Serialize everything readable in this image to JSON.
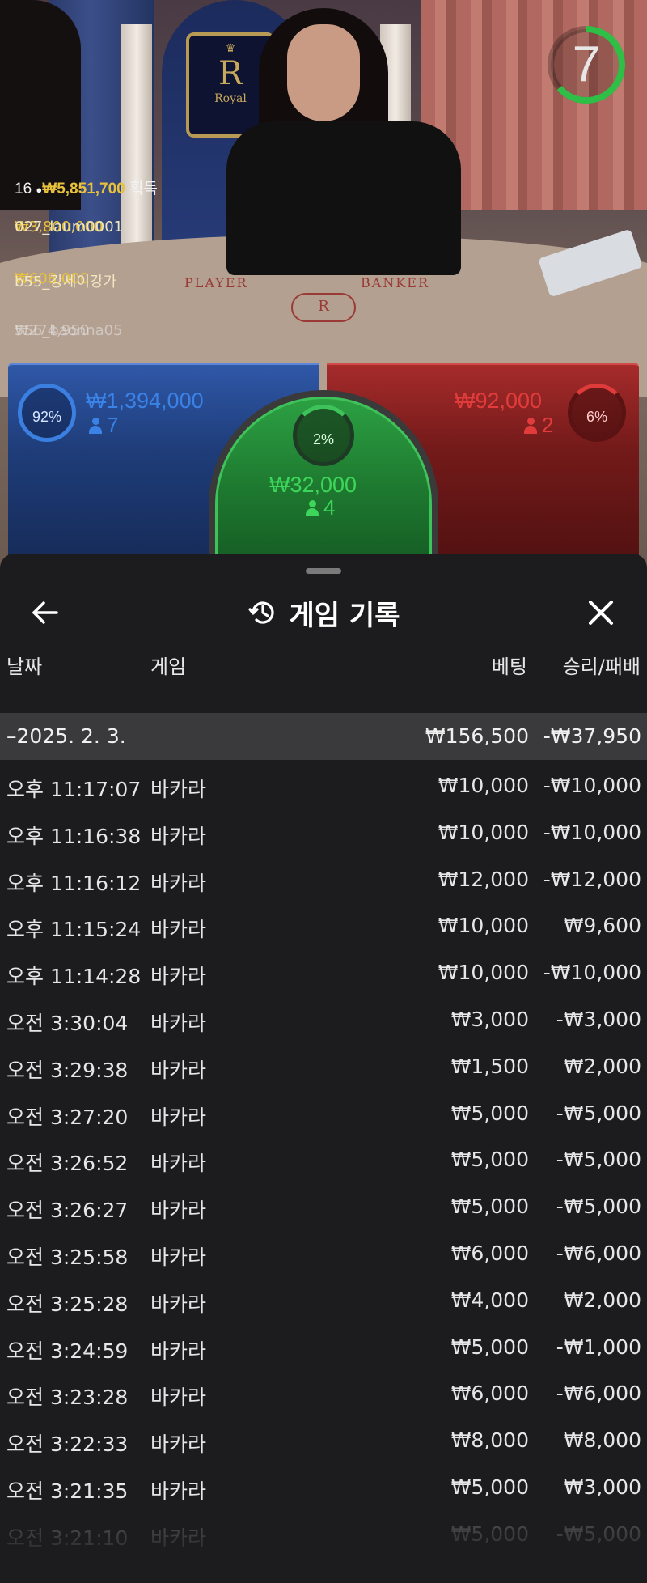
{
  "video": {
    "countdown": "7",
    "table_labels": {
      "player": "PLAYER",
      "banker": "BANKER"
    },
    "crest_text": "Royal",
    "winners": {
      "count": "16",
      "total": "₩5,851,700",
      "total_suffix": "획득",
      "list": [
        {
          "amount": "₩3,800,000",
          "name": "027_laum0001"
        },
        {
          "amount": "₩608,000",
          "name": "b55_강세이강가"
        },
        {
          "amount": "₩274,950",
          "name": "556_baonna05"
        }
      ]
    }
  },
  "bets": {
    "player": {
      "percent": "92%",
      "amount": "₩1,394,000",
      "count": "7",
      "color": "#3b82e6"
    },
    "tie": {
      "percent": "2%",
      "amount": "₩32,000",
      "count": "4",
      "color": "#3ed65a"
    },
    "banker": {
      "percent": "6%",
      "amount": "₩92,000",
      "count": "2",
      "color": "#e13b3b"
    }
  },
  "history": {
    "title": "게임 기록",
    "columns": {
      "date": "날짜",
      "game": "게임",
      "bet": "베팅",
      "result": "승리/패배"
    },
    "date_group": {
      "date": "–2025. 2. 3.",
      "bet_total": "₩156,500",
      "result_total": "-₩37,950"
    },
    "rows": [
      {
        "time": "오후 11:17:07",
        "game": "바카라",
        "bet": "₩10,000",
        "result": "-₩10,000"
      },
      {
        "time": "오후 11:16:38",
        "game": "바카라",
        "bet": "₩10,000",
        "result": "-₩10,000"
      },
      {
        "time": "오후 11:16:12",
        "game": "바카라",
        "bet": "₩12,000",
        "result": "-₩12,000"
      },
      {
        "time": "오후 11:15:24",
        "game": "바카라",
        "bet": "₩10,000",
        "result": "₩9,600"
      },
      {
        "time": "오후 11:14:28",
        "game": "바카라",
        "bet": "₩10,000",
        "result": "-₩10,000"
      },
      {
        "time": "오전 3:30:04",
        "game": "바카라",
        "bet": "₩3,000",
        "result": "-₩3,000"
      },
      {
        "time": "오전 3:29:38",
        "game": "바카라",
        "bet": "₩1,500",
        "result": "₩2,000"
      },
      {
        "time": "오전 3:27:20",
        "game": "바카라",
        "bet": "₩5,000",
        "result": "-₩5,000"
      },
      {
        "time": "오전 3:26:52",
        "game": "바카라",
        "bet": "₩5,000",
        "result": "-₩5,000"
      },
      {
        "time": "오전 3:26:27",
        "game": "바카라",
        "bet": "₩5,000",
        "result": "-₩5,000"
      },
      {
        "time": "오전 3:25:58",
        "game": "바카라",
        "bet": "₩6,000",
        "result": "-₩6,000"
      },
      {
        "time": "오전 3:25:28",
        "game": "바카라",
        "bet": "₩4,000",
        "result": "₩2,000"
      },
      {
        "time": "오전 3:24:59",
        "game": "바카라",
        "bet": "₩5,000",
        "result": "-₩1,000"
      },
      {
        "time": "오전 3:23:28",
        "game": "바카라",
        "bet": "₩6,000",
        "result": "-₩6,000"
      },
      {
        "time": "오전 3:22:33",
        "game": "바카라",
        "bet": "₩8,000",
        "result": "₩8,000"
      },
      {
        "time": "오전 3:21:35",
        "game": "바카라",
        "bet": "₩5,000",
        "result": "₩3,000"
      },
      {
        "time": "오전 3:21:10",
        "game": "바카라",
        "bet": "₩5,000",
        "result": "-₩5,000"
      }
    ]
  },
  "icons": {
    "back": "arrow-left-icon",
    "history": "history-clock-icon",
    "close": "close-icon",
    "person": "person-icon"
  }
}
